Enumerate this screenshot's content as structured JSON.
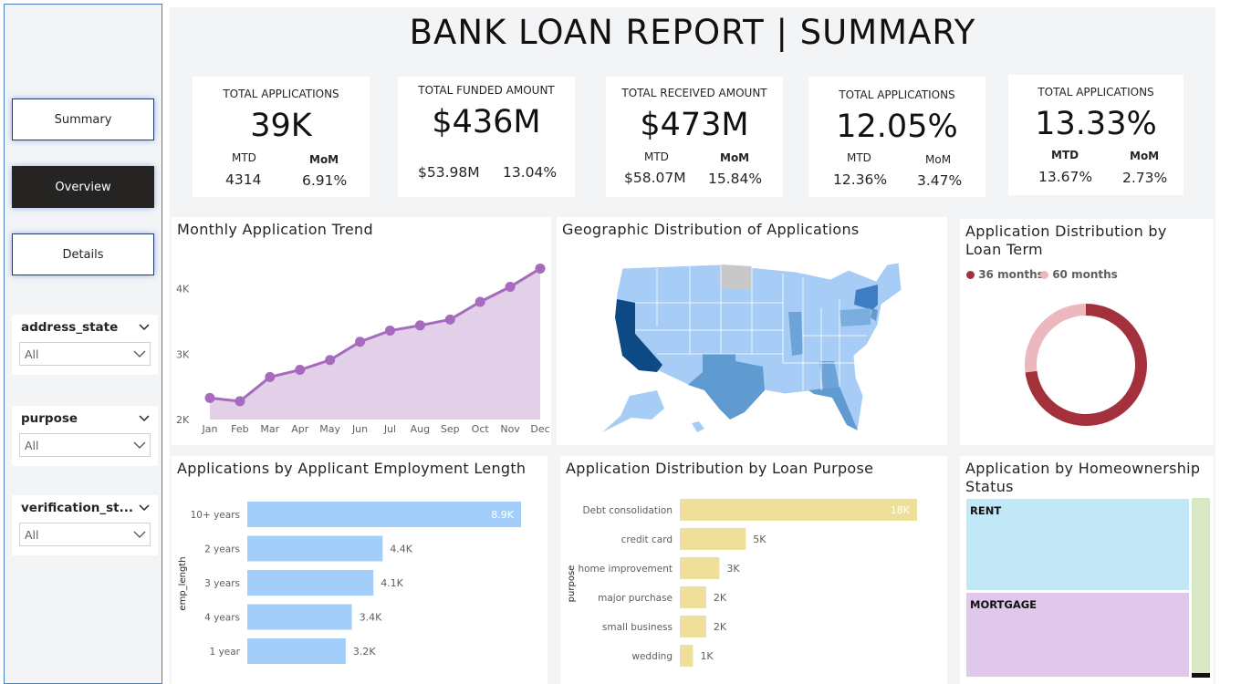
{
  "title": "BANK LOAN REPORT | SUMMARY",
  "nav": {
    "summary": "Summary",
    "overview": "Overview",
    "details": "Details"
  },
  "filters": [
    {
      "name": "address_state",
      "value": "All"
    },
    {
      "name": "purpose",
      "value": "All"
    },
    {
      "name": "verification_st...",
      "value": "All"
    }
  ],
  "kpis": [
    {
      "label": "TOTAL APPLICATIONS",
      "value": "39K",
      "mtd_label": "MTD",
      "mom_label": "MoM",
      "mtd": "4314",
      "mom": "6.91%"
    },
    {
      "label": "TOTAL FUNDED AMOUNT",
      "value": "$436M",
      "mtd": "$53.98M",
      "mom": "13.04%"
    },
    {
      "label": "TOTAL RECEIVED AMOUNT",
      "value": "$473M",
      "mtd_label": "MTD",
      "mom_label": "MoM",
      "mtd": "$58.07M",
      "mom": "15.84%"
    },
    {
      "label": "TOTAL APPLICATIONS",
      "value": "12.05%",
      "mtd_label": "MTD",
      "mom_label": "MoM",
      "mtd": "12.36%",
      "mom": "3.47%"
    },
    {
      "label": "TOTAL APPLICATIONS",
      "value": "13.33%",
      "mtd_label": "MTD",
      "mom_label": "MoM",
      "mtd": "13.67%",
      "mom": "2.73%"
    }
  ],
  "colors": {
    "trend": "#a66bbf",
    "trend_fill": "#e2cfe8",
    "emp_bar": "#a3cef9",
    "purpose_bar": "#eedf9b",
    "term_36": "#a3303a",
    "term_60": "#ecb8bd",
    "rent": "#c2e8f8",
    "mortgage": "#e0c8ea",
    "own": "#d8e8c4"
  },
  "chart_data": [
    {
      "type": "area",
      "title": "Monthly Application Trend",
      "categories": [
        "Jan",
        "Feb",
        "Mar",
        "Apr",
        "May",
        "Jun",
        "Jul",
        "Aug",
        "Sep",
        "Oct",
        "Nov",
        "Dec"
      ],
      "values": [
        2330,
        2280,
        2650,
        2760,
        2910,
        3190,
        3360,
        3440,
        3530,
        3800,
        4030,
        4310
      ],
      "ylim": [
        2000,
        4400
      ],
      "yticks": [
        "2K",
        "3K",
        "4K"
      ]
    },
    {
      "type": "map",
      "title": "Geographic Distribution of Applications"
    },
    {
      "type": "pie",
      "title": "Application Distribution by Loan Term",
      "labels": [
        "36 months",
        "60 months"
      ],
      "values": [
        73,
        27
      ]
    },
    {
      "type": "bar",
      "title": "Applications by Applicant Employment Length",
      "ylabel": "emp_length",
      "categories": [
        "10+ years",
        "2 years",
        "3 years",
        "4 years",
        "1 year"
      ],
      "values": [
        8900,
        4400,
        4100,
        3400,
        3200
      ],
      "labels": [
        "8.9K",
        "4.4K",
        "4.1K",
        "3.4K",
        "3.2K"
      ]
    },
    {
      "type": "bar",
      "title": "Application Distribution by Loan Purpose",
      "ylabel": "purpose",
      "categories": [
        "Debt consolidation",
        "credit card",
        "home improvement",
        "major purchase",
        "small business",
        "wedding"
      ],
      "values": [
        18000,
        5000,
        3000,
        2000,
        2000,
        1000
      ],
      "labels": [
        "18K",
        "5K",
        "3K",
        "2K",
        "2K",
        "1K"
      ]
    },
    {
      "type": "treemap",
      "title": "Application by Homeownership Status",
      "labels": [
        "RENT",
        "MORTGAGE"
      ]
    }
  ]
}
